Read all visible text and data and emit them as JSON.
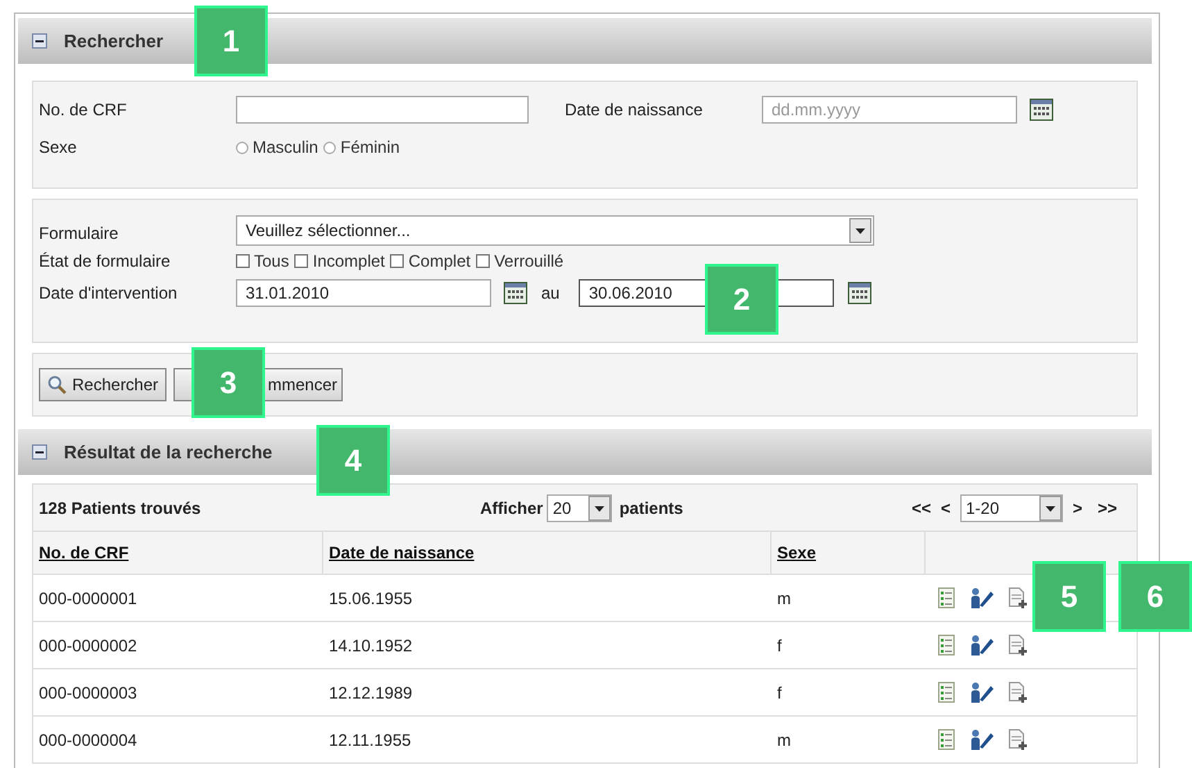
{
  "search_panel": {
    "title": "Rechercher",
    "expanded": true,
    "criteria": {
      "crf_label": "No. de CRF",
      "birth_label": "Date de naissance",
      "birth_placeholder": "dd.mm.yyyy",
      "sex_label": "Sexe",
      "sex_options": [
        {
          "label": "Masculin",
          "selected": false
        },
        {
          "label": "Féminin",
          "selected": false
        }
      ]
    },
    "form_filters": {
      "form_label": "Formulaire",
      "form_value": "Veuillez sélectionner...",
      "state_label": "État de formulaire",
      "states": [
        {
          "label": "Tous",
          "checked": false
        },
        {
          "label": "Incomplet",
          "checked": false
        },
        {
          "label": "Complet",
          "checked": false
        },
        {
          "label": "Verrouillé",
          "checked": false
        }
      ],
      "date_label": "Date d'intervention",
      "date_from": "31.01.2010",
      "date_sep": "au",
      "date_to": "30.06.2010"
    },
    "buttons": [
      {
        "label": "Rechercher",
        "kind": "search"
      },
      {
        "label": "mmencer",
        "kind": "plain"
      }
    ]
  },
  "results_panel": {
    "title": "Résultat de la recherche",
    "expanded": true,
    "count": "128 Patients trouvés",
    "show_label": "Afficher",
    "page_size": "20",
    "show_suffix": "patients",
    "pager": {
      "first": "<<",
      "prev": "<",
      "range": "1-20",
      "next": ">",
      "last": ">>"
    },
    "columns": [
      "No. de CRF",
      "Date de naissance",
      "Sexe"
    ],
    "rows": [
      {
        "crf": "000-0000001",
        "birth": "15.06.1955",
        "sex": "m"
      },
      {
        "crf": "000-0000002",
        "birth": "14.10.1952",
        "sex": "f"
      },
      {
        "crf": "000-0000003",
        "birth": "12.12.1989",
        "sex": "f"
      },
      {
        "crf": "000-0000004",
        "birth": "12.11.1955",
        "sex": "m"
      }
    ]
  },
  "callouts": [
    "1",
    "2",
    "3",
    "4",
    "5",
    "6"
  ]
}
